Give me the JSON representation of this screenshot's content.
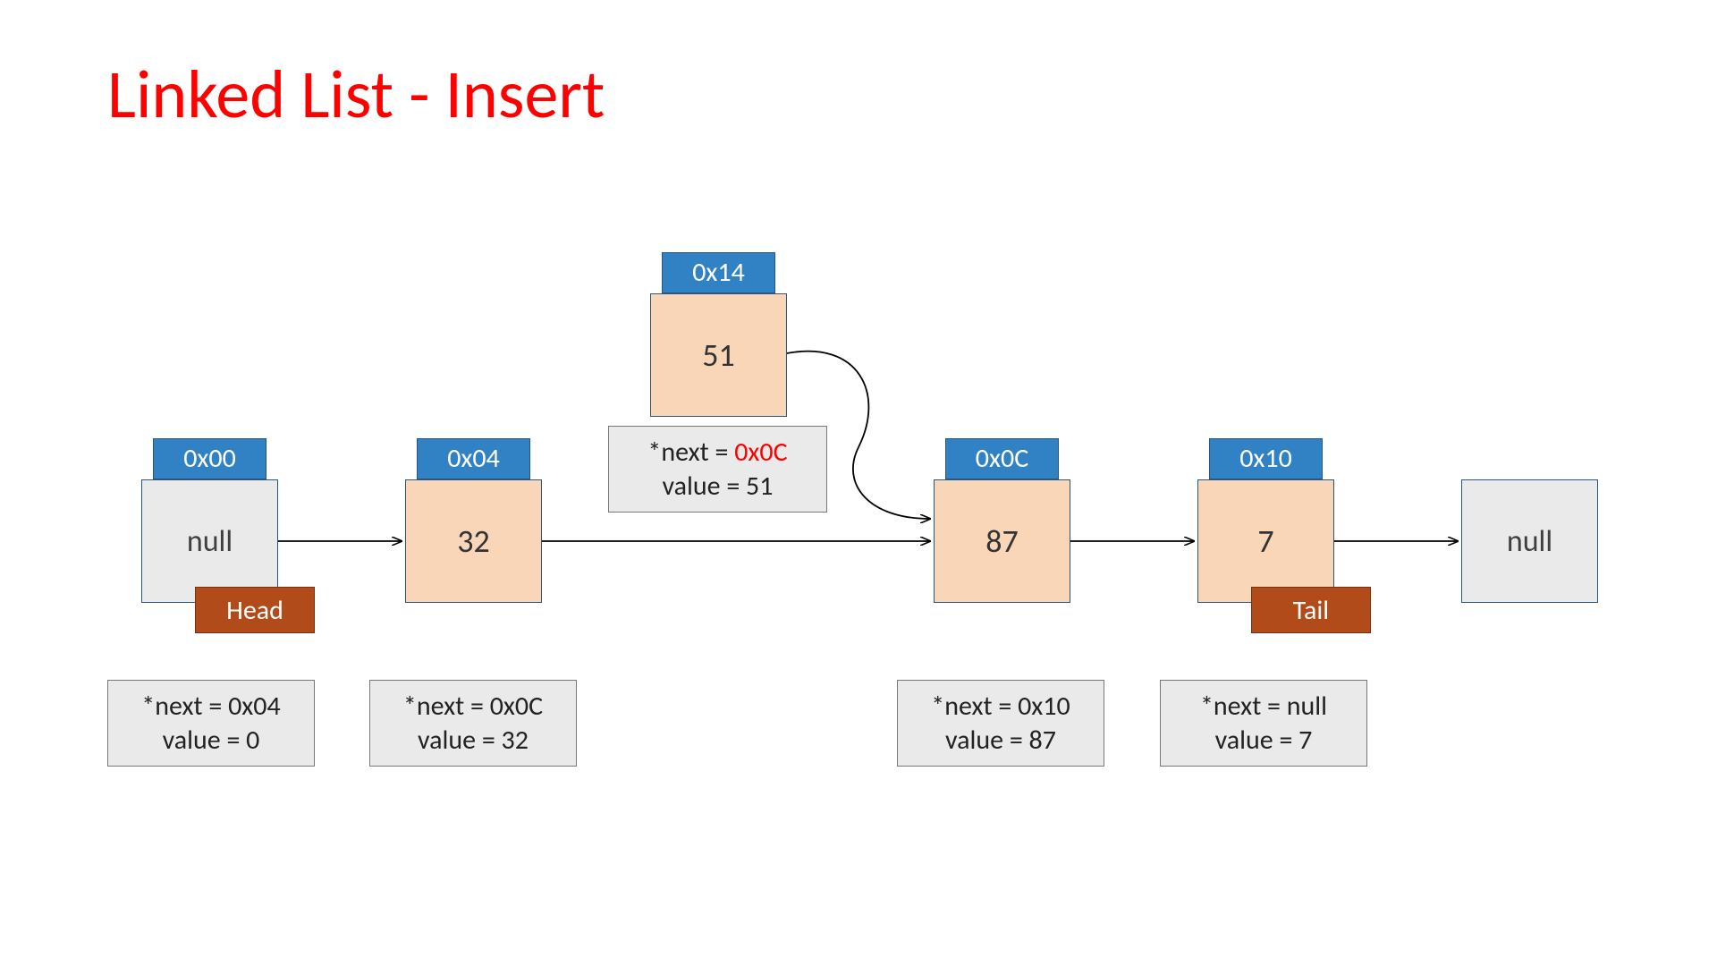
{
  "title": "Linked List - Insert",
  "node0": {
    "addr": "0x00",
    "body": "null",
    "tag": "Head",
    "info_next": "*next = 0x04",
    "info_value": "value = 0"
  },
  "node1": {
    "addr": "0x04",
    "body": "32",
    "info_next": "*next = 0x0C",
    "info_value": "value = 32"
  },
  "insert": {
    "addr": "0x14",
    "body": "51",
    "info_next_prefix": "*next = ",
    "info_next_addr": "0x0C",
    "info_value": "value = 51"
  },
  "node2": {
    "addr": "0x0C",
    "body": "87",
    "info_next": "*next = 0x10",
    "info_value": "value = 87"
  },
  "node3": {
    "addr": "0x10",
    "body": "7",
    "tag": "Tail",
    "info_next": "*next = null",
    "info_value": "value = 7"
  },
  "terminal": {
    "body": "null"
  }
}
